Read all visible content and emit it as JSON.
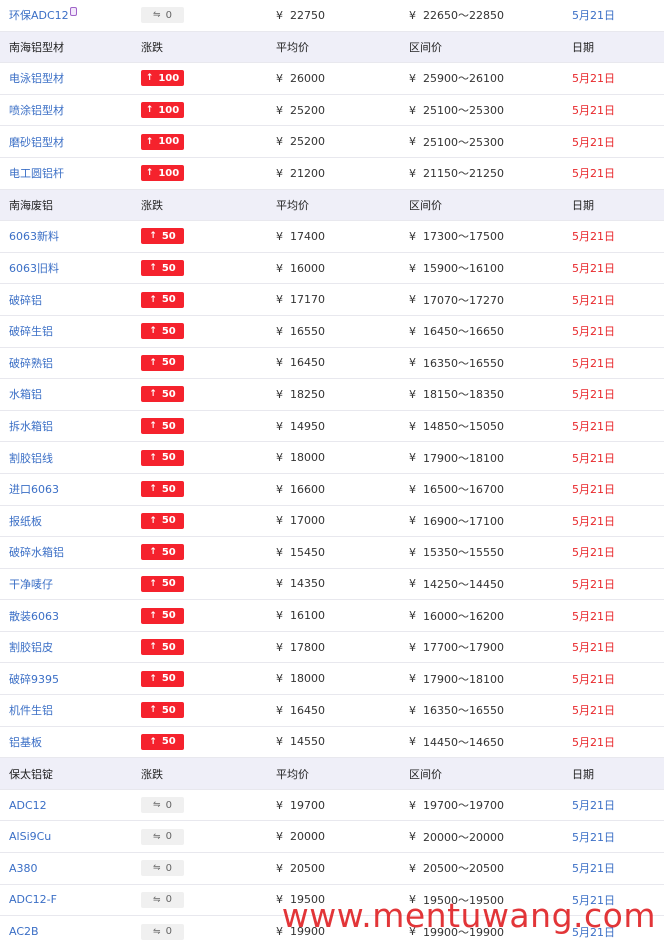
{
  "sections": [
    {
      "rows": [
        {
          "name": "环保ADC12",
          "change": "0",
          "dir": "flat",
          "avg": "22750",
          "range": "22650～22850",
          "date": "5月21日",
          "date_color": "blue",
          "badge_icon": true
        }
      ]
    },
    {
      "header": {
        "name": "南海铝型材",
        "change": "涨跌",
        "avg": "平均价",
        "range": "区间价",
        "date": "日期"
      },
      "rows": [
        {
          "name": "电泳铝型材",
          "change": "100",
          "dir": "up",
          "avg": "26000",
          "range": "25900～26100",
          "date": "5月21日",
          "date_color": "red"
        },
        {
          "name": "喷涂铝型材",
          "change": "100",
          "dir": "up",
          "avg": "25200",
          "range": "25100～25300",
          "date": "5月21日",
          "date_color": "red"
        },
        {
          "name": "磨砂铝型材",
          "change": "100",
          "dir": "up",
          "avg": "25200",
          "range": "25100～25300",
          "date": "5月21日",
          "date_color": "red"
        },
        {
          "name": "电工圆铝杆",
          "change": "100",
          "dir": "up",
          "avg": "21200",
          "range": "21150～21250",
          "date": "5月21日",
          "date_color": "red"
        }
      ]
    },
    {
      "header": {
        "name": "南海废铝",
        "change": "涨跌",
        "avg": "平均价",
        "range": "区间价",
        "date": "日期"
      },
      "rows": [
        {
          "name": "6063新料",
          "change": "50",
          "dir": "up",
          "avg": "17400",
          "range": "17300～17500",
          "date": "5月21日",
          "date_color": "red"
        },
        {
          "name": "6063旧料",
          "change": "50",
          "dir": "up",
          "avg": "16000",
          "range": "15900～16100",
          "date": "5月21日",
          "date_color": "red"
        },
        {
          "name": "破碎铝",
          "change": "50",
          "dir": "up",
          "avg": "17170",
          "range": "17070～17270",
          "date": "5月21日",
          "date_color": "red"
        },
        {
          "name": "破碎生铝",
          "change": "50",
          "dir": "up",
          "avg": "16550",
          "range": "16450～16650",
          "date": "5月21日",
          "date_color": "red"
        },
        {
          "name": "破碎熟铝",
          "change": "50",
          "dir": "up",
          "avg": "16450",
          "range": "16350～16550",
          "date": "5月21日",
          "date_color": "red"
        },
        {
          "name": "水箱铝",
          "change": "50",
          "dir": "up",
          "avg": "18250",
          "range": "18150～18350",
          "date": "5月21日",
          "date_color": "red"
        },
        {
          "name": "拆水箱铝",
          "change": "50",
          "dir": "up",
          "avg": "14950",
          "range": "14850～15050",
          "date": "5月21日",
          "date_color": "red"
        },
        {
          "name": "割胶铝线",
          "change": "50",
          "dir": "up",
          "avg": "18000",
          "range": "17900～18100",
          "date": "5月21日",
          "date_color": "red"
        },
        {
          "name": "进口6063",
          "change": "50",
          "dir": "up",
          "avg": "16600",
          "range": "16500～16700",
          "date": "5月21日",
          "date_color": "red"
        },
        {
          "name": "报纸板",
          "change": "50",
          "dir": "up",
          "avg": "17000",
          "range": "16900～17100",
          "date": "5月21日",
          "date_color": "red"
        },
        {
          "name": "破碎水箱铝",
          "change": "50",
          "dir": "up",
          "avg": "15450",
          "range": "15350～15550",
          "date": "5月21日",
          "date_color": "red"
        },
        {
          "name": "干净唛仔",
          "change": "50",
          "dir": "up",
          "avg": "14350",
          "range": "14250～14450",
          "date": "5月21日",
          "date_color": "red"
        },
        {
          "name": "散装6063",
          "change": "50",
          "dir": "up",
          "avg": "16100",
          "range": "16000～16200",
          "date": "5月21日",
          "date_color": "red"
        },
        {
          "name": "割胶铝皮",
          "change": "50",
          "dir": "up",
          "avg": "17800",
          "range": "17700～17900",
          "date": "5月21日",
          "date_color": "red"
        },
        {
          "name": "破碎9395",
          "change": "50",
          "dir": "up",
          "avg": "18000",
          "range": "17900～18100",
          "date": "5月21日",
          "date_color": "red"
        },
        {
          "name": "机件生铝",
          "change": "50",
          "dir": "up",
          "avg": "16450",
          "range": "16350～16550",
          "date": "5月21日",
          "date_color": "red"
        },
        {
          "name": "铝基板",
          "change": "50",
          "dir": "up",
          "avg": "14550",
          "range": "14450～14650",
          "date": "5月21日",
          "date_color": "red"
        }
      ]
    },
    {
      "header": {
        "name": "保太铝锭",
        "change": "涨跌",
        "avg": "平均价",
        "range": "区间价",
        "date": "日期"
      },
      "rows": [
        {
          "name": "ADC12",
          "change": "0",
          "dir": "flat",
          "avg": "19700",
          "range": "19700～19700",
          "date": "5月21日",
          "date_color": "blue"
        },
        {
          "name": "AlSi9Cu",
          "change": "0",
          "dir": "flat",
          "avg": "20000",
          "range": "20000～20000",
          "date": "5月21日",
          "date_color": "blue"
        },
        {
          "name": "A380",
          "change": "0",
          "dir": "flat",
          "avg": "20500",
          "range": "20500～20500",
          "date": "5月21日",
          "date_color": "blue"
        },
        {
          "name": "ADC12-F",
          "change": "0",
          "dir": "flat",
          "avg": "19500",
          "range": "19500～19500",
          "date": "5月21日",
          "date_color": "blue"
        },
        {
          "name": "AC2B",
          "change": "0",
          "dir": "flat",
          "avg": "19900",
          "range": "19900～19900",
          "date": "5月21日",
          "date_color": "blue"
        }
      ]
    }
  ],
  "currency_symbol": "¥",
  "arrow_up": "↑",
  "arrow_flat": "⇋",
  "watermark_text": "www.mentuwang.com",
  "colors": {
    "up": "#f5222d",
    "link": "#3b6fc6",
    "date_red": "#e8262a",
    "header_bg": "#efeff8",
    "watermark": "#e0262a"
  }
}
